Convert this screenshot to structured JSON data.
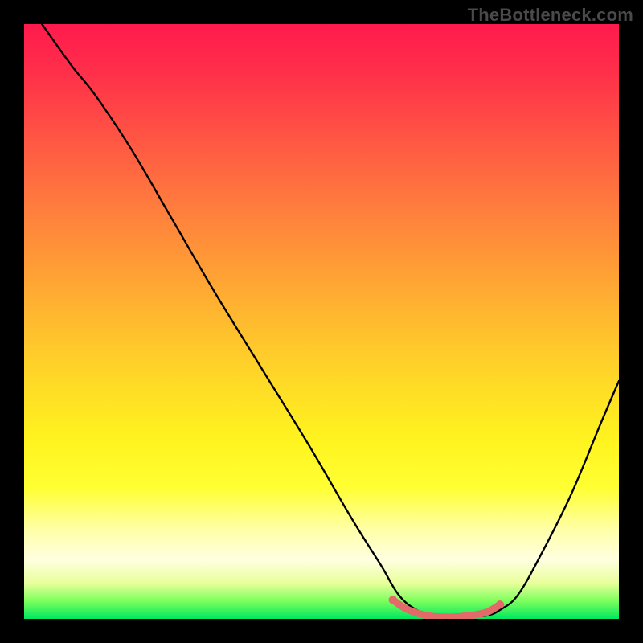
{
  "watermark": "TheBottleneck.com",
  "chart_data": {
    "type": "line",
    "title": "",
    "xlabel": "",
    "ylabel": "",
    "xlim": [
      0,
      100
    ],
    "ylim": [
      0,
      100
    ],
    "background": "red-yellow-green vertical gradient (high=red, low=green)",
    "series": [
      {
        "name": "main-curve",
        "color": "#000000",
        "x": [
          3,
          8,
          12,
          18,
          25,
          32,
          40,
          48,
          55,
          60,
          63,
          66,
          69,
          72,
          75,
          78,
          80,
          83,
          87,
          92,
          97,
          100
        ],
        "y": [
          100,
          93,
          88,
          79,
          67,
          55,
          42,
          29,
          17,
          9,
          4,
          1.5,
          0.5,
          0.3,
          0.3,
          0.6,
          1.5,
          4,
          11,
          21,
          33,
          40
        ]
      },
      {
        "name": "highlight-trough",
        "color": "#e46a6a",
        "stroke_width": 7,
        "x": [
          62,
          64,
          66,
          68,
          70,
          72,
          74,
          76,
          78,
          80
        ],
        "y": [
          3.2,
          1.8,
          1.0,
          0.5,
          0.3,
          0.3,
          0.4,
          0.7,
          1.2,
          2.4
        ]
      }
    ]
  }
}
